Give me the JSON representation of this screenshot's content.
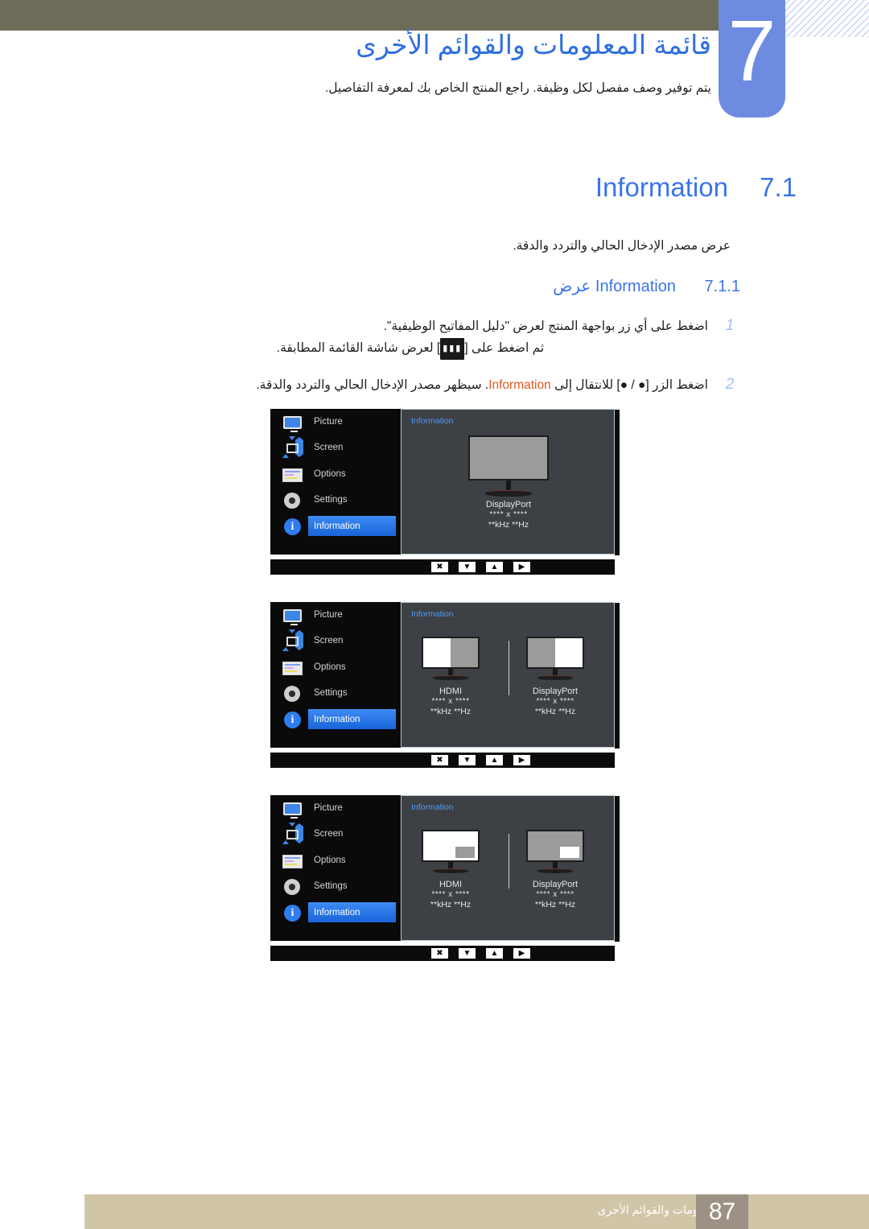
{
  "header": {
    "chapter_number": "7",
    "chapter_title": "قائمة المعلومات والقوائم الأخرى",
    "chapter_subtitle": "يتم توفير وصف مفصل لكل وظيفة. راجع المنتج الخاص بك لمعرفة التفاصيل."
  },
  "section": {
    "number": "7.1",
    "title": "Information",
    "lead": "عرض مصدر الإدخال الحالي والتردد والدقة.",
    "sub_number": "7.1.1",
    "sub_title_en": "Information",
    "sub_title_ar": "عرض"
  },
  "steps": [
    {
      "num": "1",
      "line1_a": "اضغط على أي زر بواجهة المنتج لعرض \"دليل المفاتيح الوظيفية\".",
      "line2_a": "ثم اضغط على",
      "line2_key": "▮▮▮",
      "line2_b": "لعرض شاشة القائمة المطابقة."
    },
    {
      "num": "2",
      "line1_a": "اضغط الزر [● / ●] للانتقال إلى",
      "line1_kw": "Information",
      "line1_b": ". سيظهر مصدر الإدخال الحالي والتردد والدقة."
    }
  ],
  "osd": {
    "menu_items": [
      {
        "label": "Picture",
        "icon": "monitor-icon",
        "selected": false
      },
      {
        "label": "Screen",
        "icon": "arrows-icon",
        "selected": false
      },
      {
        "label": "Options",
        "icon": "list-icon",
        "selected": false
      },
      {
        "label": "Settings",
        "icon": "gear-icon",
        "selected": false
      },
      {
        "label": "Information",
        "icon": "info-icon",
        "selected": true
      }
    ],
    "pane_caption": "Information",
    "buttons": [
      {
        "glyph": "✖",
        "name": "close-button"
      },
      {
        "glyph": "▼",
        "name": "down-button"
      },
      {
        "glyph": "▲",
        "name": "up-button"
      },
      {
        "glyph": "▶",
        "name": "enter-button"
      }
    ],
    "panels": [
      {
        "id": "single-source",
        "mode": "single",
        "monitors": [
          {
            "source": "DisplayPort",
            "resolution": "**** x ****",
            "frequency": "**kHz **Hz",
            "fill": "grey"
          }
        ]
      },
      {
        "id": "pbp-dual-source",
        "mode": "pbp",
        "monitors": [
          {
            "source": "HDMI",
            "resolution": "**** x ****",
            "frequency": "**kHz **Hz",
            "fill": "split-left-white"
          },
          {
            "source": "DisplayPort",
            "resolution": "**** x ****",
            "frequency": "**kHz **Hz",
            "fill": "split-right-white"
          }
        ]
      },
      {
        "id": "pip-dual-source",
        "mode": "pip",
        "monitors": [
          {
            "source": "HDMI",
            "resolution": "**** x ****",
            "frequency": "**kHz **Hz",
            "fill": "white-with-grey-inset"
          },
          {
            "source": "DisplayPort",
            "resolution": "**** x ****",
            "frequency": "**kHz **Hz",
            "fill": "grey-with-white-inset"
          }
        ]
      }
    ]
  },
  "footer": {
    "text": "قائمة المعلومات والقوائم الأخرى",
    "page": "87"
  },
  "colors": {
    "header_bar": "#6d6c58",
    "chapter_blue": "#6e8be2",
    "heading_blue": "#3b74e8",
    "keyword_orange": "#e2561f",
    "footer_tan": "#d0c5a7",
    "page_box": "#9c9184",
    "osd_highlight": "#3e8bf4"
  }
}
